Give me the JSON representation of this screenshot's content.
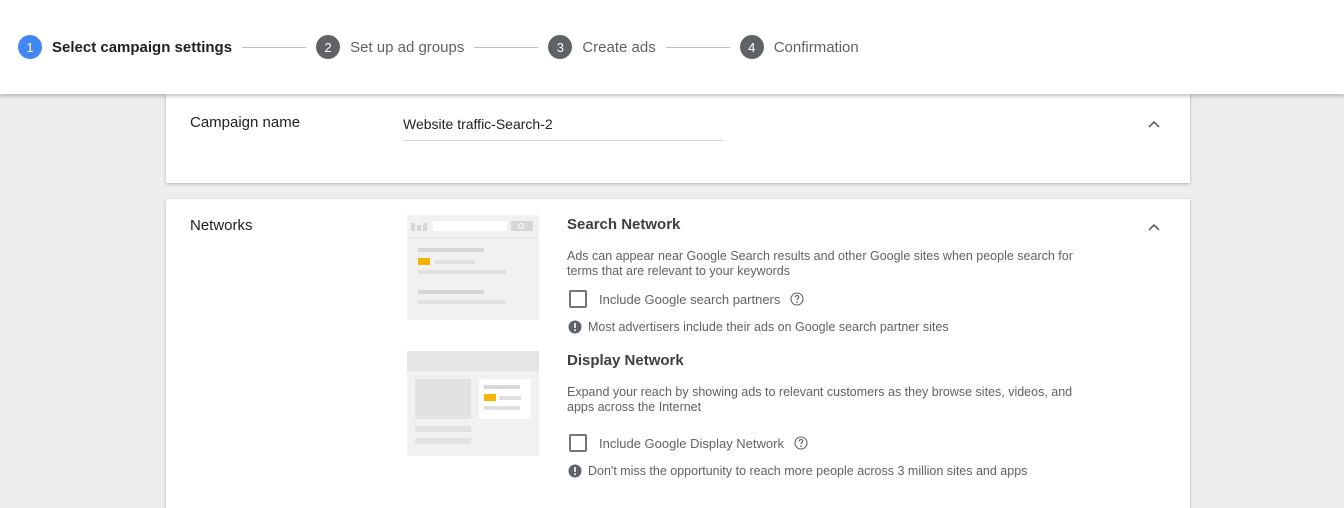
{
  "stepper": {
    "steps": [
      {
        "number": "1",
        "label": "Select campaign settings"
      },
      {
        "number": "2",
        "label": "Set up ad groups"
      },
      {
        "number": "3",
        "label": "Create ads"
      },
      {
        "number": "4",
        "label": "Confirmation"
      }
    ]
  },
  "campaign": {
    "label": "Campaign name",
    "value": "Website traffic-Search-2"
  },
  "networks": {
    "label": "Networks",
    "search": {
      "title": "Search Network",
      "description": "Ads can appear near Google Search results and other Google sites when people search for terms that are relevant to your keywords",
      "checkbox_label": "Include Google search partners",
      "hint": "Most advertisers include their ads on Google search partner sites"
    },
    "display": {
      "title": "Display Network",
      "description": "Expand your reach by showing ads to relevant customers as they browse sites, videos, and apps across the Internet",
      "checkbox_label": "Include Google Display Network",
      "hint": "Don't miss the opportunity to reach more people across 3 million sites and apps"
    }
  },
  "colors": {
    "active_step": "#4285f4",
    "inactive_step": "#5f6368",
    "illustration_accent": "#f4b400"
  }
}
